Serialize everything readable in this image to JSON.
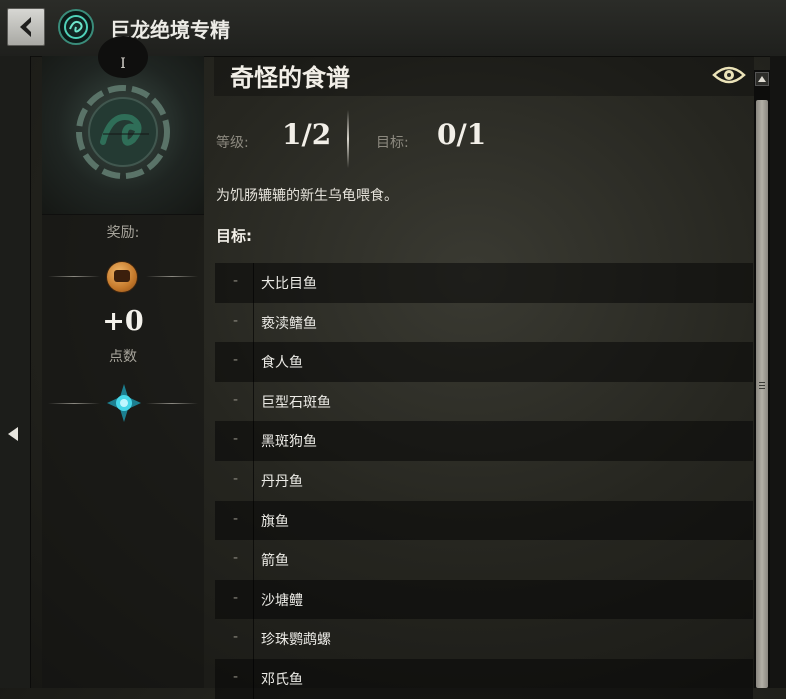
{
  "header": {
    "back_icon": "chevron-left-icon",
    "mastery_icon": "dragon-emblem-icon",
    "title": "巨龙绝境专精"
  },
  "left_nav": {
    "collapse_icon": "triangle-left-icon"
  },
  "reward_panel": {
    "tier": "I",
    "reward_label": "奖励:",
    "reward_icon": "mastery-chest-icon",
    "points_value": "+0",
    "points_label": "点数",
    "mastery_point_icon": "mastery-star-icon"
  },
  "achievement": {
    "title": "奇怪的食谱",
    "watch_icon": "eye-icon",
    "level_label": "等级:",
    "level_value": "1/2",
    "goal_label": "目标:",
    "goal_value": "0/1",
    "description": "为饥肠辘辘的新生乌龟喂食。",
    "objectives_heading": "目标:",
    "objectives": [
      {
        "dash": "-",
        "text": "大比目鱼"
      },
      {
        "dash": "-",
        "text": "亵渎鳍鱼"
      },
      {
        "dash": "-",
        "text": "食人鱼"
      },
      {
        "dash": "-",
        "text": "巨型石斑鱼"
      },
      {
        "dash": "-",
        "text": "黑斑狗鱼"
      },
      {
        "dash": "-",
        "text": "丹丹鱼"
      },
      {
        "dash": "-",
        "text": "旗鱼"
      },
      {
        "dash": "-",
        "text": "箭鱼"
      },
      {
        "dash": "-",
        "text": "沙塘鳢"
      },
      {
        "dash": "-",
        "text": "珍珠鹦鹉螺"
      },
      {
        "dash": "-",
        "text": "邓氏鱼"
      }
    ]
  },
  "colors": {
    "accent_teal": "#3fb8a4",
    "reward_orange": "#d98c3a",
    "text_primary": "#f2efe8",
    "text_muted": "#8c897f"
  }
}
